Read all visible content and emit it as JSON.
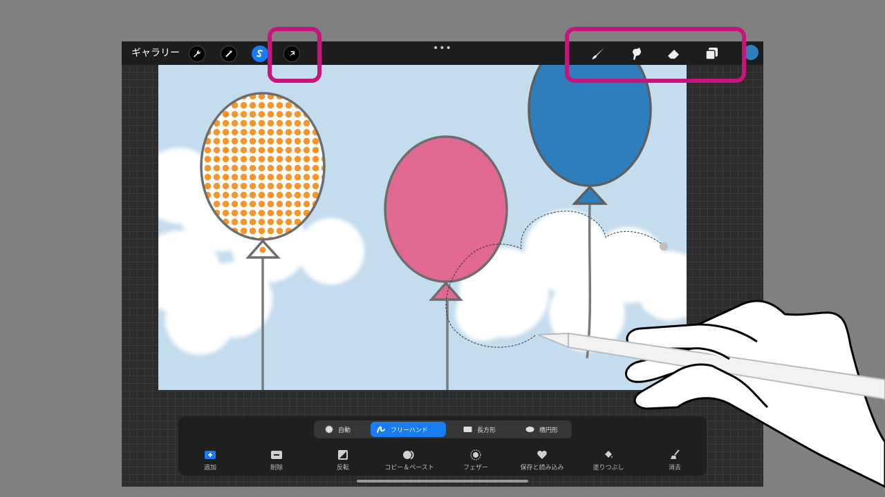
{
  "topbar": {
    "gallery_label": "ギャラリー",
    "more_label": "•••",
    "left_tools": [
      {
        "name": "wrench-icon"
      },
      {
        "name": "magic-wand-icon"
      },
      {
        "name": "selection-s-icon"
      },
      {
        "name": "transform-arrow-icon"
      }
    ],
    "right_tools": [
      {
        "name": "brush-icon"
      },
      {
        "name": "smudge-icon"
      },
      {
        "name": "eraser-icon"
      },
      {
        "name": "layers-icon"
      }
    ],
    "current_color": "#2e7ebd"
  },
  "selection_modes": [
    {
      "label": "自動",
      "icon": "auto-icon",
      "active": false
    },
    {
      "label": "フリーハンド",
      "icon": "freehand-icon",
      "active": true
    },
    {
      "label": "長方形",
      "icon": "rectangle-icon",
      "active": false
    },
    {
      "label": "楕円形",
      "icon": "ellipse-icon",
      "active": false
    }
  ],
  "actions": [
    {
      "label": "追加",
      "icon": "plus-icon"
    },
    {
      "label": "削除",
      "icon": "minus-icon"
    },
    {
      "label": "反転",
      "icon": "invert-icon"
    },
    {
      "label": "コピー＆ペースト",
      "icon": "copy-paste-icon"
    },
    {
      "label": "フェザー",
      "icon": "feather-icon"
    },
    {
      "label": "保存と読み込み",
      "icon": "heart-icon"
    },
    {
      "label": "塗りつぶし",
      "icon": "fill-bucket-icon"
    },
    {
      "label": "消去",
      "icon": "clear-broom-icon"
    }
  ],
  "colors": {
    "highlight": "#c8137e",
    "accent": "#1a7cf5",
    "sky": "#c3dcee",
    "balloon_orange": "#f7952a",
    "balloon_pink": "#e06892",
    "balloon_blue": "#2e7ebd"
  }
}
